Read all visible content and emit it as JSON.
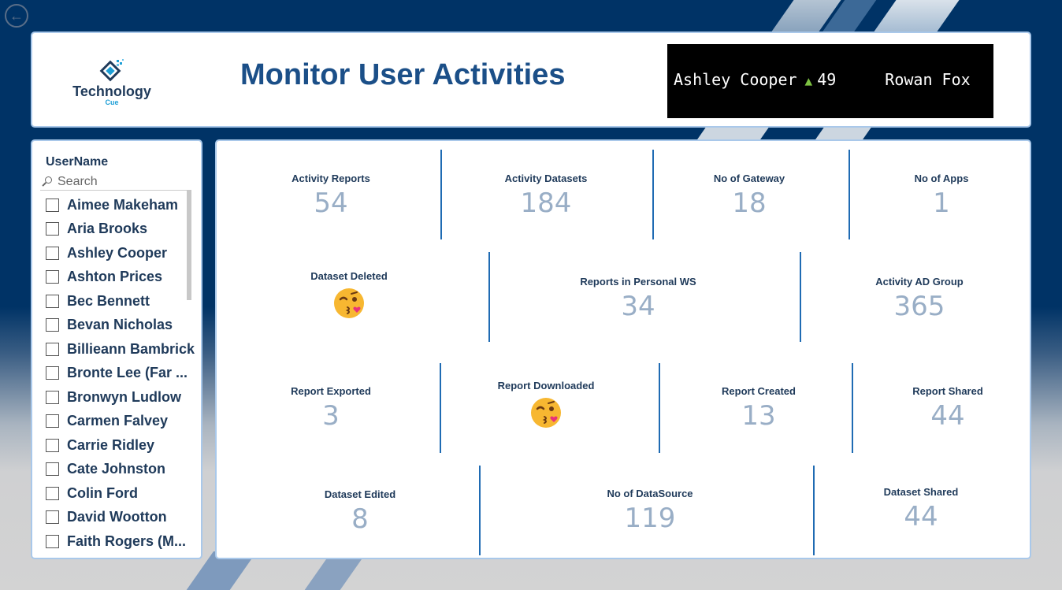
{
  "header": {
    "logo_text": "Technology",
    "logo_sub": "Cue",
    "title": "Monitor User Activities",
    "ticker": [
      {
        "name": "Ashley Cooper",
        "arrow": "▲",
        "value": "49"
      },
      {
        "name": "Rowan Fox"
      }
    ]
  },
  "slicer": {
    "title": "UserName",
    "search_placeholder": "Search",
    "items": [
      "Aimee Makeham",
      "Aria Brooks",
      "Ashley Cooper",
      "Ashton Prices",
      "Bec Bennett",
      "Bevan Nicholas",
      "Billieann Bambrick",
      "Bronte Lee (Far ...",
      "Bronwyn Ludlow",
      "Carmen Falvey",
      "Carrie Ridley",
      "Cate Johnston",
      "Colin Ford",
      "David Wootton",
      "Faith Rogers (M..."
    ]
  },
  "kpis": {
    "activity_reports": {
      "label": "Activity Reports",
      "value": "54"
    },
    "activity_datasets": {
      "label": "Activity Datasets",
      "value": "184"
    },
    "no_of_gateway": {
      "label": "No of Gateway",
      "value": "18"
    },
    "no_of_apps": {
      "label": "No of Apps",
      "value": "1"
    },
    "dataset_deleted": {
      "label": "Dataset Deleted",
      "icon": "kissing-wink-emoji-icon"
    },
    "reports_personal_ws": {
      "label": "Reports in Personal WS",
      "value": "34"
    },
    "activity_ad_group": {
      "label": "Activity AD Group",
      "value": "365"
    },
    "report_exported": {
      "label": "Report Exported",
      "value": "3"
    },
    "report_downloaded": {
      "label": "Report Downloaded",
      "icon": "kissing-wink-emoji-icon"
    },
    "report_created": {
      "label": "Report Created",
      "value": "13"
    },
    "report_shared": {
      "label": "Report Shared",
      "value": "44"
    },
    "dataset_edited": {
      "label": "Dataset Edited",
      "value": "8"
    },
    "no_of_datasource": {
      "label": "No of DataSource",
      "value": "119"
    },
    "dataset_shared": {
      "label": "Dataset Shared",
      "value": "44"
    }
  },
  "colors": {
    "background": "#003366",
    "title": "#1b4f88",
    "kpi_value": "#99aec6",
    "divider": "#1f6bb3",
    "ticker_up": "#7dc242"
  }
}
